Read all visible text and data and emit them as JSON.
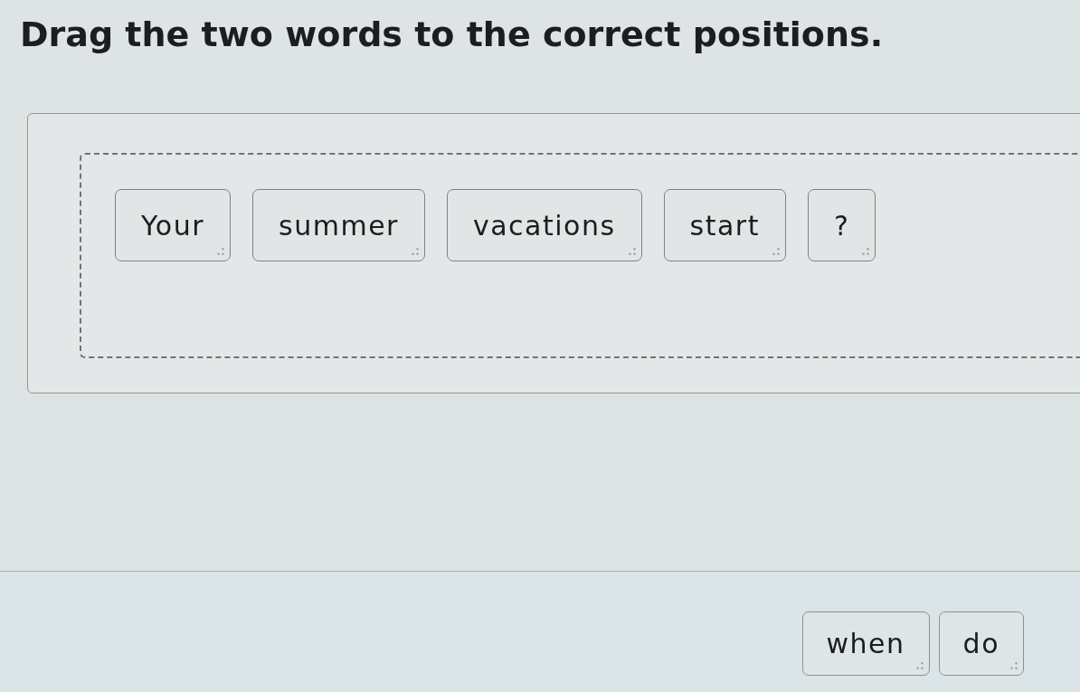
{
  "instruction": "Drag the two words to the correct positions.",
  "answer_area": {
    "tiles": [
      {
        "text": "Your"
      },
      {
        "text": "summer"
      },
      {
        "text": "vacations"
      },
      {
        "text": "start"
      },
      {
        "text": "?"
      }
    ]
  },
  "word_bank": {
    "tiles": [
      {
        "text": "when"
      },
      {
        "text": "do"
      }
    ]
  }
}
